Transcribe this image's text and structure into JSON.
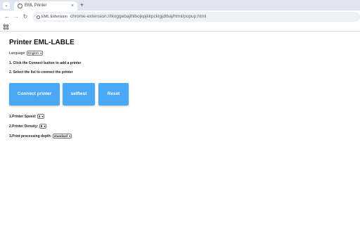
{
  "browser": {
    "tab_title": "EML Printer",
    "tab_close": "×",
    "new_tab": "+",
    "tab_dropdown": "⌄",
    "back": "←",
    "forward": "→",
    "reload": "↻",
    "site_chip": "EML Extension",
    "url": "chrome-extension://lkoggebajlhlbojkpjkkpcklgjdlbaj/html/popup.html"
  },
  "page": {
    "title": "Printer EML-LABLE",
    "language": {
      "label": "Language:",
      "selected": "English"
    },
    "instructions": [
      "1. Click the Connect button to add a printer",
      "2. Select the list to connect the printer"
    ],
    "buttons": {
      "connect": "Connect printer",
      "selftest": "selftest",
      "reset": "Reset"
    },
    "settings": {
      "speed": {
        "label": "1.Printer Speed:",
        "selected": "4"
      },
      "density": {
        "label": "2.Printer Density:",
        "selected": "8"
      },
      "processing": {
        "label": "3.Print processing depth:",
        "selected": "standard"
      }
    },
    "colors": {
      "button": "#4aa8f7"
    }
  }
}
